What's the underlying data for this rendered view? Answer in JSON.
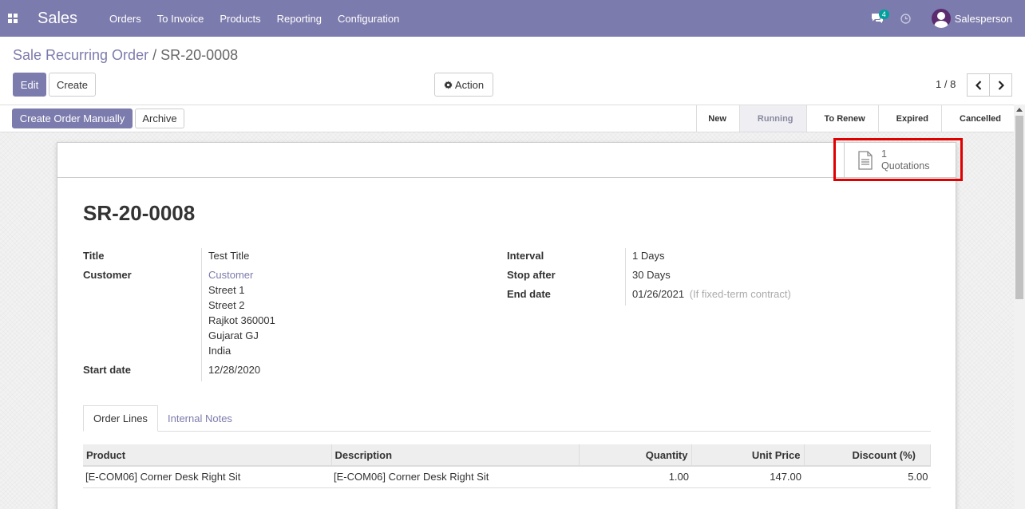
{
  "navbar": {
    "app_name": "Sales",
    "menu": [
      "Orders",
      "To Invoice",
      "Products",
      "Reporting",
      "Configuration"
    ],
    "chat_count": "4",
    "user": "Salesperson"
  },
  "control": {
    "breadcrumb_parent": "Sale Recurring Order",
    "breadcrumb_sep": "/",
    "breadcrumb_current": "SR-20-0008",
    "edit_label": "Edit",
    "create_label": "Create",
    "action_label": "Action",
    "pager": "1 / 8"
  },
  "statusbar": {
    "create_manual_label": "Create Order Manually",
    "archive_label": "Archive",
    "steps": [
      "New",
      "Running",
      "To Renew",
      "Expired",
      "Cancelled"
    ],
    "active_step": "Running"
  },
  "smart_button": {
    "count": "1",
    "label": "Quotations"
  },
  "record": {
    "name": "SR-20-0008",
    "fields": {
      "title_label": "Title",
      "title_value": "Test Title",
      "customer_label": "Customer",
      "customer_value": "Customer",
      "address": [
        "Street 1",
        "Street 2",
        "Rajkot 360001",
        "Gujarat GJ",
        "India"
      ],
      "start_label": "Start date",
      "start_value": "12/28/2020",
      "interval_label": "Interval",
      "interval_value": "1 Days",
      "stop_label": "Stop after",
      "stop_value": "30 Days",
      "end_label": "End date",
      "end_value": "01/26/2021",
      "end_hint": "(If fixed-term contract)"
    }
  },
  "tabs": [
    "Order Lines",
    "Internal Notes"
  ],
  "table": {
    "headers": [
      "Product",
      "Description",
      "Quantity",
      "Unit Price",
      "Discount (%)"
    ],
    "rows": [
      [
        "[E-COM06] Corner Desk Right Sit",
        "[E-COM06] Corner Desk Right Sit",
        "1.00",
        "147.00",
        "5.00"
      ]
    ]
  },
  "colors": {
    "brand": "#7c7bad",
    "highlight": "#e00000",
    "badge": "#00a09d"
  }
}
